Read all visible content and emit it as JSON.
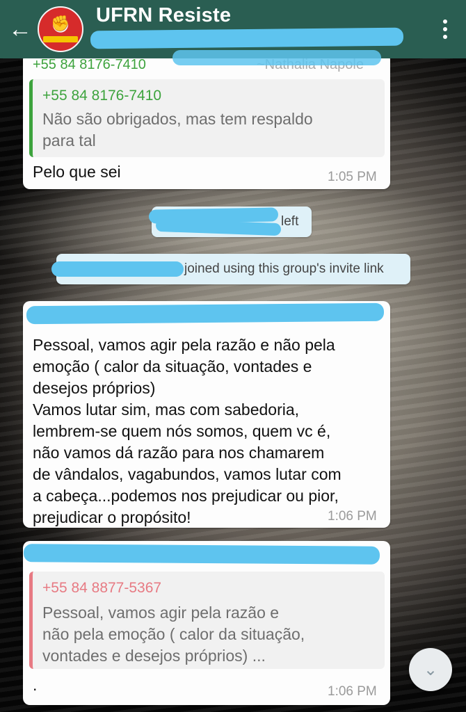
{
  "header": {
    "title": "UFRN Resiste",
    "back_icon": "arrow-left-icon",
    "menu_icon": "more-vertical-icon"
  },
  "messages": {
    "m1": {
      "top_sender": "+55 84 8176-7410",
      "top_name": "~Nathalia Napole",
      "quote_sender": "+55 84 8176-7410",
      "quote_text_1": "Não são obrigados, mas tem respaldo",
      "quote_text_2": "para tal",
      "text": "Pelo que sei",
      "time": "1:05 PM"
    },
    "sys1": {
      "text": "left"
    },
    "sys2": {
      "text": "joined using this group's invite link"
    },
    "m2": {
      "lines": [
        "Pessoal, vamos agir pela razão e não pela",
        "emoção ( calor da situação, vontades e",
        "desejos próprios)",
        "Vamos lutar sim, mas com sabedoria,",
        "lembrem-se quem nós somos, quem vc é,",
        "não vamos dá razão para nos chamarem",
        "de vândalos, vagabundos, vamos lutar com",
        "a cabeça...podemos nos prejudicar ou pior,",
        "prejudicar o propósito!"
      ],
      "time": "1:06 PM"
    },
    "m3": {
      "quote_sender": "+55 84 8877-5367",
      "quote_lines": [
        "Pessoal, vamos agir pela razão e",
        "não pela emoção ( calor da situação,",
        "vontades e desejos próprios) ..."
      ],
      "text": ".",
      "time": "1:06 PM"
    }
  },
  "colors": {
    "header": "#2a5e52",
    "quote_green": "#3da33d",
    "quote_red": "#e77a83",
    "redaction": "#5ec4ef"
  }
}
